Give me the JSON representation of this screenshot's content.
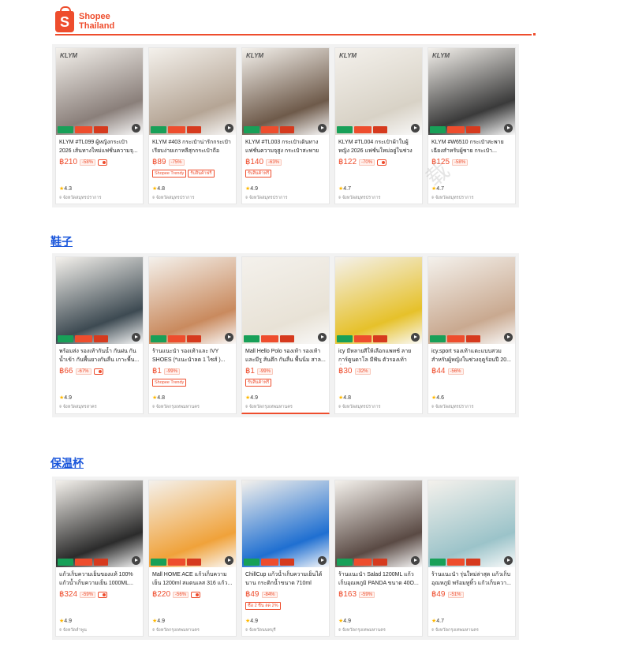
{
  "header": {
    "logo_line1": "Shopee",
    "logo_line2": "Thailand",
    "logo_glyph": "S"
  },
  "sections": [
    {
      "title": "",
      "products": [
        {
          "brand": "KLYM",
          "title": "KLYM #TL099 ผู้หญิงกระเป๋า 2026 เส้นทางใหม่แฟชั่นความจุ...",
          "price": "฿210",
          "discount": "-58%",
          "chips": [],
          "rating": "4.3",
          "location": "จังหวัดสมุทรปราการ",
          "img_color": "#8a7f7a"
        },
        {
          "brand": "",
          "title": "KLYM #403 กระเป๋าน่ารักกระเป๋าเรียบง่ายเกาหลีสุกกระเป๋าถือกระ...",
          "price": "฿89",
          "discount": "-75%",
          "chips": [
            "Shopee Trendy",
            "รับสินค้าฟรี"
          ],
          "rating": "4.8",
          "location": "จังหวัดสมุทรปราการ",
          "img_color": "#b5a595"
        },
        {
          "brand": "KLYM",
          "title": "KLYM #TL003 กระเป๋าเดินทางแฟชั่นความจุสูง กระเป๋าสะพายข้...",
          "price": "฿140",
          "discount": "-63%",
          "chips": [
            "รับสินค้าฟรี"
          ],
          "rating": "4.9",
          "location": "จังหวัดสมุทรปราการ",
          "img_color": "#6e5a4a"
        },
        {
          "brand": "KLYM",
          "title": "KLYM #TL004 กระเป๋าผ้าใบผู้หญิง 2026 แฟชั่นใหม่อยู่ในช่วงฤดู...",
          "price": "฿122",
          "discount": "-70%",
          "chips": [],
          "rating": "4.7",
          "location": "จังหวัดสมุทรปราการ",
          "img_color": "#d8d2c6"
        },
        {
          "brand": "KLYM",
          "title": "KLYM #W6510 กระเป๋าสะพายเฉียงสำหรับผู้ชาย กระเป๋า...",
          "price": "฿125",
          "discount": "-58%",
          "chips": [],
          "rating": "4.7",
          "location": "จังหวัดสมุทรปราการ",
          "img_color": "#3a3a3a"
        }
      ]
    },
    {
      "title": "鞋子",
      "products": [
        {
          "brand": "",
          "title": "พร้อมส่ง รองเท้ากันน้ำ กันฝน กันน้ำเข้า กันพื้นยางกันลื่น เกาะพื้น...",
          "price": "฿66",
          "discount": "-67%",
          "chips": [],
          "rating": "4.9",
          "location": "จังหวัดสมุทรสาคร",
          "img_color": "#3d4a52"
        },
        {
          "brand": "",
          "title": "ร้านแนะนำ รองเท้าและ IVY SHOES (*แนะนำลด 1 ไซส์ )...",
          "tag": "ร้านแนะนำ",
          "price": "฿1",
          "discount": "-99%",
          "chips": [
            "Shopee Trendy"
          ],
          "rating": "4.8",
          "location": "จังหวัดกรุงเทพมหานคร",
          "img_color": "#c98a5e"
        },
        {
          "brand": "",
          "title": "Mall Hello Polo รองเท้า รองเท้าและมีรู ส้นตึก กันลื่น พื้นนิ่ม สาล...",
          "tag": "Mall",
          "price": "฿1",
          "discount": "-99%",
          "chips": [
            "รับสินค้าฟรี"
          ],
          "rating": "4.9",
          "location": "จังหวัดกรุงเทพมหานคร",
          "img_color": "#e8e2d6"
        },
        {
          "brand": "",
          "title": "icy มีหลายสีให้เลือกแพทช์ ลายการ์ตูนดาโล มีฟัน ตัวรองเท้าพื้น...",
          "price": "฿30",
          "discount": "-32%",
          "chips": [],
          "rating": "4.8",
          "location": "จังหวัดสมุทรปราการ",
          "img_color": "#e6c12a"
        },
        {
          "brand": "",
          "title": "icy.sport รองเท้าแตะแบบสวมสำหรับผู้หญิงในช่วงฤดูร้อนปี 20...",
          "price": "฿44",
          "discount": "-56%",
          "chips": [],
          "rating": "4.6",
          "location": "จังหวัดสมุทรปราการ",
          "img_color": "#c9a990"
        }
      ]
    },
    {
      "title": "保温杯",
      "products": [
        {
          "brand": "",
          "title": "แก้วเก็บความเย็นของแท้ 100% แก้วน้ำเก็บความเย็น 1000ML...",
          "price": "฿324",
          "discount": "-59%",
          "chips": [],
          "rating": "4.9",
          "location": "จังหวัดลำพูน",
          "img_color": "#2b2b2b"
        },
        {
          "brand": "",
          "title": "Mall HOME ACE แก้วเก็บความเย็น 1200ml สแตนเลส 316 แก้ว...",
          "tag": "Mall",
          "price": "฿220",
          "discount": "-56%",
          "chips": [],
          "rating": "4.9",
          "location": "จังหวัดกรุงเทพมหานคร",
          "img_color": "#f0a23a"
        },
        {
          "brand": "",
          "title": "ChillCup แก้วน้ำเก็บความเย็นได้นาน กระติกน้ำขนาด 710ml กระ...",
          "price": "฿49",
          "discount": "-84%",
          "chips": [
            "ซื้อ 2 ชิ้น ลด 2%"
          ],
          "rating": "4.9",
          "location": "จังหวัดนนทบุรี",
          "img_color": "#1f6fd1"
        },
        {
          "brand": "",
          "title": "ร้านแนะนำ Salad 1200ML แก้วเก็บอุณหภูมิ PANDA ขนาด 40O...",
          "tag": "ร้านแนะนำ",
          "price": "฿163",
          "discount": "-59%",
          "chips": [],
          "rating": "4.9",
          "location": "จังหวัดกรุงเทพมหานคร",
          "img_color": "#5a4a44"
        },
        {
          "brand": "",
          "title": "ร้านแนะนำ รุ่นใหม่ล่าสุด แก้วเก็บอุณหภูมิ พร้อมหูหิ้ว แก้วเก็บควา...",
          "tag": "ร้านแนะนำ",
          "price": "฿49",
          "discount": "-51%",
          "chips": [],
          "rating": "4.7",
          "location": "จังหวัดกรุงเทพมหานคร",
          "img_color": "#9bc3c9"
        }
      ]
    }
  ]
}
